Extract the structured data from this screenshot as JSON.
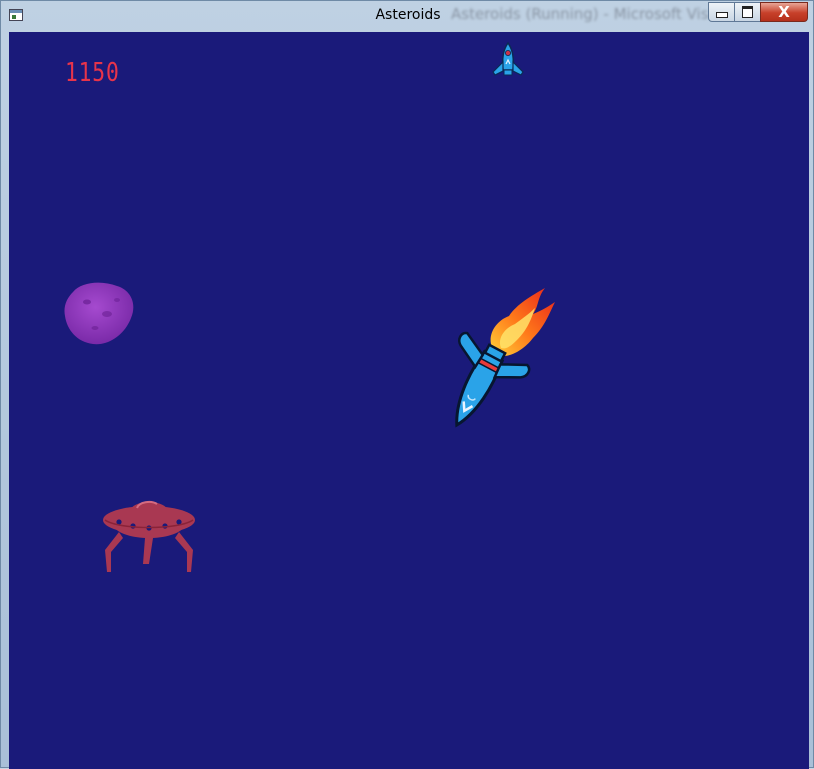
{
  "window": {
    "title": "Asteroids",
    "background_title": "Asteroids (Running) - Microsoft Visu"
  },
  "controls": {
    "minimize_icon": "minimize-icon",
    "maximize_icon": "maximize-icon",
    "close_icon": "close-icon",
    "close_glyph": "X"
  },
  "game": {
    "score": "1150",
    "lives": 1,
    "background_color": "#1a1a7a",
    "score_color": "#e8344a",
    "sprites": {
      "life_icon": "rocket-icon",
      "player": "player-rocket-with-flame",
      "asteroid": "purple-asteroid",
      "enemy": "red-ufo"
    }
  }
}
